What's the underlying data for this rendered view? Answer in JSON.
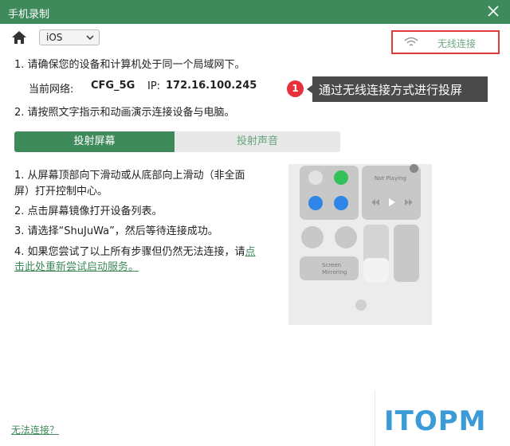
{
  "window": {
    "title": "手机录制"
  },
  "toolbar": {
    "os_selected": "iOS",
    "wireless_label": "无线连接"
  },
  "instructions": {
    "line1": "1. 请确保您的设备和计算机处于同一个局域网下。",
    "network_label": "当前网络:",
    "network_value": "CFG_5G",
    "ip_label": "IP:",
    "ip_value": "172.16.100.245",
    "line2": "2. 请按照文字指示和动画演示连接设备与电脑。"
  },
  "annotation": {
    "number": "1",
    "text": "通过无线连接方式进行投屏"
  },
  "tabs": [
    {
      "label": "投射屏幕"
    },
    {
      "label": "投射声音"
    }
  ],
  "steps": {
    "s1a": "1. 从屏幕顶部向下滑动或从底部向上滑动（非全面",
    "s1b": "屏）打开控制中心。",
    "s2": "2. 点击屏幕镜像打开设备列表。",
    "s3": "3. 请选择“ShuJuWa”，然后等待连接成功。",
    "s4a": "4. 如果您尝试了以上所有步骤但仍然无法连接，请",
    "s4_link_a": "点",
    "s4_link_b": "击此处重新尝试启动服务。"
  },
  "phone": {
    "now_playing": "Not Playing",
    "mirror_line1": "Screen",
    "mirror_line2": "Mirroring"
  },
  "footer": {
    "cant_connect": "无法连接？"
  },
  "watermark": "ITOPM",
  "colors": {
    "accent": "#3f8a5b",
    "highlight": "#e03a3a",
    "annotation_bg": "#4a4a4a",
    "watermark": "#3b9bd6"
  }
}
